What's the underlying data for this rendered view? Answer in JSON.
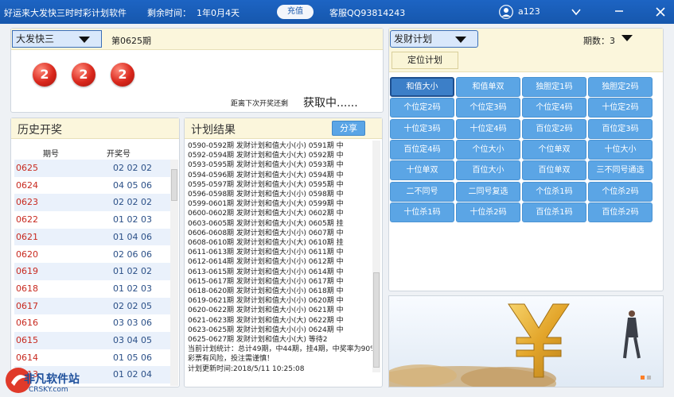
{
  "titlebar": {
    "app_name": "好运来大发快三时时彩计划软件",
    "remaining_label": "剩余时间：",
    "remaining_value": "1年0月4天",
    "recharge": "充值",
    "service": "客服QQ93814243",
    "username": "a123"
  },
  "draw_panel": {
    "lottery_select": "大发快三",
    "issue": "第0625期",
    "balls": [
      "2",
      "2",
      "2"
    ],
    "countdown_label": "距离下次开奖还剩",
    "countdown_value": "获取中......"
  },
  "history": {
    "title": "历史开奖",
    "col_issue": "期号",
    "col_numbers": "开奖号",
    "rows": [
      {
        "issue": "0625",
        "nums": "02 02 02"
      },
      {
        "issue": "0624",
        "nums": "04 05 06"
      },
      {
        "issue": "0623",
        "nums": "02 02 02"
      },
      {
        "issue": "0622",
        "nums": "01 02 03"
      },
      {
        "issue": "0621",
        "nums": "01 04 06"
      },
      {
        "issue": "0620",
        "nums": "02 06 06"
      },
      {
        "issue": "0619",
        "nums": "01 02 02"
      },
      {
        "issue": "0618",
        "nums": "01 02 03"
      },
      {
        "issue": "0617",
        "nums": "02 02 05"
      },
      {
        "issue": "0616",
        "nums": "03 03 06"
      },
      {
        "issue": "0615",
        "nums": "03 04 05"
      },
      {
        "issue": "0614",
        "nums": "01 05 06"
      },
      {
        "issue": "0613",
        "nums": "01 02 04"
      }
    ]
  },
  "plan_result": {
    "title": "计划结果",
    "share": "分享",
    "lines": [
      "0590-0592期 发财计划和值大小(小) 0591期 中",
      "0592-0594期 发财计划和值大小(大) 0592期 中",
      "0593-0595期 发财计划和值大小(大) 0593期 中",
      "0594-0596期 发财计划和值大小(大) 0594期 中",
      "0595-0597期 发财计划和值大小(大) 0595期 中",
      "0596-0598期 发财计划和值大小(小) 0598期 中",
      "0599-0601期 发财计划和值大小(大) 0599期 中",
      "0600-0602期 发财计划和值大小(大) 0602期 中",
      "0603-0605期 发财计划和值大小(大) 0605期 挂",
      "0606-0608期 发财计划和值大小(小) 0607期 中",
      "0608-0610期 发财计划和值大小(大) 0610期 挂",
      "0611-0613期 发财计划和值大小(小) 0611期 中",
      "0612-0614期 发财计划和值大小(小) 0612期 中",
      "0613-0615期 发财计划和值大小(小) 0614期 中",
      "0615-0617期 发财计划和值大小(小) 0617期 中",
      "0618-0620期 发财计划和值大小(小) 0618期 中",
      "0619-0621期 发财计划和值大小(小) 0620期 中",
      "0620-0622期 发财计划和值大小(小) 0621期 中",
      "0621-0623期 发财计划和值大小(大) 0622期 中",
      "0623-0625期 发财计划和值大小(小) 0624期 中",
      "0625-0627期 发财计划和值大小(大) 等待2",
      "当前计划统计：总计49期，中44期，挂4期，中奖率为90%",
      "彩票有风险，投注需谨慎！",
      "计划更新时间:2018/5/11 10:25:08"
    ]
  },
  "plan_panel": {
    "plan_select": "发财计划",
    "period_label": "期数：3",
    "dingwei": "定位计划",
    "buttons": [
      "和值大小",
      "和值单双",
      "独胆定1码",
      "独胆定2码",
      "个位定2码",
      "个位定3码",
      "个位定4码",
      "十位定2码",
      "十位定3码",
      "十位定4码",
      "百位定2码",
      "百位定3码",
      "百位定4码",
      "个位大小",
      "个位单双",
      "十位大小",
      "十位单双",
      "百位大小",
      "百位单双",
      "三不同号通选",
      "二不同号",
      "二同号复选",
      "个位杀1码",
      "个位杀2码",
      "十位杀1码",
      "十位杀2码",
      "百位杀1码",
      "百位杀2码"
    ]
  },
  "watermark": {
    "cn": "非凡软件站",
    "en": "CRSKY.com"
  }
}
